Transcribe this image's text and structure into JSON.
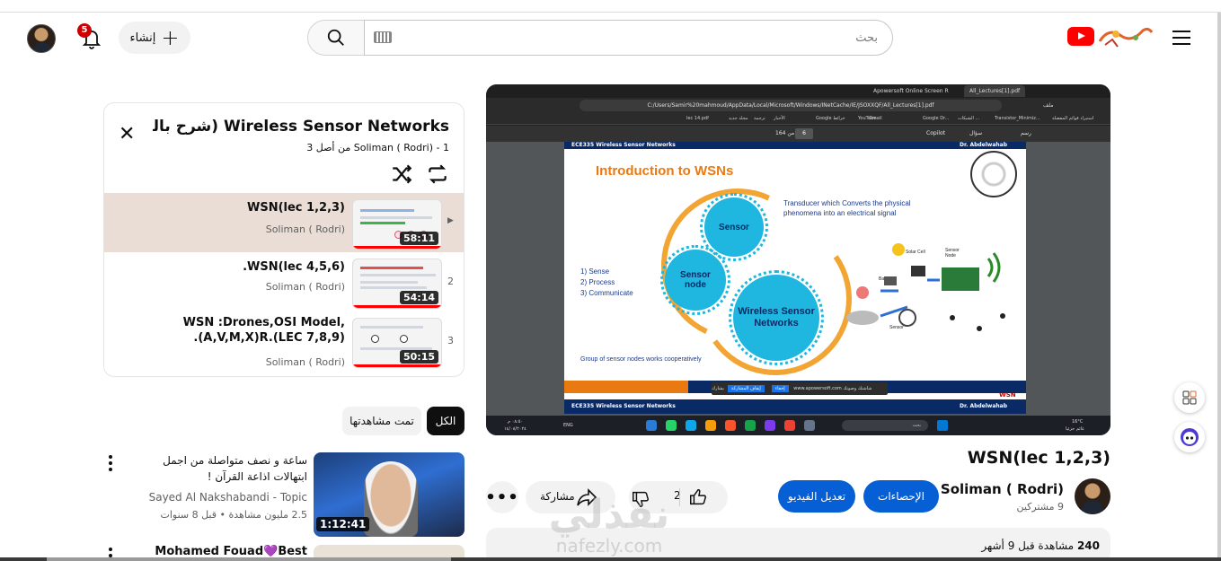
{
  "header": {
    "search_placeholder": "بحث",
    "create_label": "إنشاء",
    "notification_count": "5"
  },
  "player": {
    "tabs": [
      "Apowersoft Online Screen R",
      "All_Lectures[1].pdf"
    ],
    "address": "C:/Users/Samir%20mahmoud/AppData/Local/Microsoft/Windows/INetCache/IE/JSOXXQF/All_Lectures[1].pdf",
    "file_label": "ملف",
    "bookmarks": [
      "استيراد قوائم المفضلة",
      "Transistor_Minimiz...",
      "الشبكات ...",
      "Google Dr...",
      "Gmail",
      "YouTube",
      "Google خرائط",
      "الأخبار",
      "ترجمة",
      "مجلد جديد",
      "lec 14.pdf"
    ],
    "pdf_toolbar": {
      "page_current": "6",
      "page_total": "من 164",
      "copilot": "Copilot",
      "ask": "سؤال",
      "draw": "رسم"
    },
    "slide": {
      "header_left": "ECE335 Wireless Sensor Networks",
      "header_right": "Dr. Abdelwahab Fawzy",
      "title": "Introduction to WSNs",
      "transducer_line1": "Transducer which Converts the physical",
      "transducer_line2": "phenomena into an electrical signal",
      "list": [
        "1)  Sense",
        "2)  Process",
        "3)  Communicate"
      ],
      "gear_sensor": "Sensor",
      "gear_node": "Sensor node",
      "gear_wsn": "Wireless Sensor Networks",
      "solar_cell": "Solar Cell",
      "sensor_node_label": "Sensor Node",
      "battery": "Battery",
      "sensor_small": "Sensor",
      "wsn_tag": "WSN",
      "group_line": "Group of sensor nodes works cooperatively",
      "share_toast": "يشارك www.apowersoft.com شاشتك وصوتك",
      "share_stop": "إيقاف المشاركة",
      "share_hide": "إخفاء",
      "footer_left": "ECE335 Wireless Sensor Networks",
      "footer_right": "Dr. Abdelwahab Fawzy"
    },
    "taskbar": {
      "time": "٠٨:٥٠ م",
      "date": "١٤/٠٨/٢٠٢٤",
      "lang": "ENG",
      "search": "بحث",
      "weather_temp": "16°C",
      "weather_desc": "غائم جزئيا"
    }
  },
  "video": {
    "title": "WSN(lec 1,2,3)",
    "channel": "Soliman ( Rodri)",
    "subscribers": "9 مشتركين",
    "stats_button": "الإحصاءات",
    "edit_button": "تعديل الفيديو",
    "likes": "2",
    "share": "مشاركة",
    "views": "240",
    "views_suffix": "مشاهدة  قبل 9 أشهر"
  },
  "watermark": {
    "text": "نفذلي",
    "url": "nafezly.com"
  },
  "playlist": {
    "title": "Wireless Sensor Networks (شرح بالعربى",
    "owner": "Soliman ( Rodri)",
    "position": "1 من أصل 3",
    "items": [
      {
        "index": "▶",
        "title": "WSN(lec 1,2,3)",
        "channel": "Soliman ( Rodri)",
        "duration": "58:11"
      },
      {
        "index": "2",
        "title": "WSN(lec 4,5,6).",
        "channel": "Soliman ( Rodri)",
        "duration": "54:14"
      },
      {
        "index": "3",
        "title": "WSN :Drones,OSI Model, (A,V,M,X)R.(LEC 7,8,9).",
        "channel": "Soliman ( Rodri)",
        "duration": "50:15"
      }
    ]
  },
  "chips": {
    "all": "الكل",
    "watched": "تمت مشاهدتها"
  },
  "recommendations": [
    {
      "title": "ساعة و نصف متواصلة من اجمل ابتهالات اذاعة القرآن !",
      "channel": "Sayed Al Nakshabandi - Topic",
      "meta": "2.5 مليون مشاهدة • قبل 8 سنوات",
      "duration": "1:12:41"
    },
    {
      "title": "Mohamed Fouad💜Best"
    }
  ],
  "colors": {
    "accent": "#065fd4",
    "brand": "#ff0000"
  }
}
